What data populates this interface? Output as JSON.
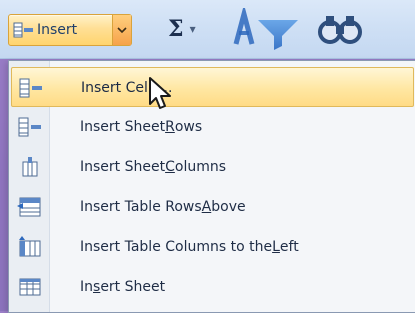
{
  "ribbon": {
    "insert_button_label": "Insert",
    "autosum_symbol": "Σ"
  },
  "menu": {
    "items": [
      {
        "label_parts": [
          "Insert C",
          "",
          "ells..."
        ],
        "display": "Insert Cells...",
        "highlighted": true
      },
      {
        "label_parts": [
          "Insert Sheet ",
          "R",
          "ows"
        ],
        "display": "Insert Sheet Rows"
      },
      {
        "label_parts": [
          "Insert Sheet ",
          "C",
          "olumns"
        ],
        "display": "Insert Sheet Columns"
      },
      {
        "label_parts": [
          "Insert Table Rows ",
          "A",
          "bove"
        ],
        "display": "Insert Table Rows Above"
      },
      {
        "label_parts": [
          "Insert Table Columns to the ",
          "L",
          "eft"
        ],
        "display": "Insert Table Columns to the Left"
      },
      {
        "label_parts": [
          "In",
          "s",
          "ert Sheet"
        ],
        "display": "Insert Sheet"
      }
    ]
  },
  "colors": {
    "highlight": "#ffe7a2",
    "highlight_border": "#e0b95b",
    "menu_bg": "#f4f6f9",
    "ribbon_bg": "#cfe0f5"
  }
}
